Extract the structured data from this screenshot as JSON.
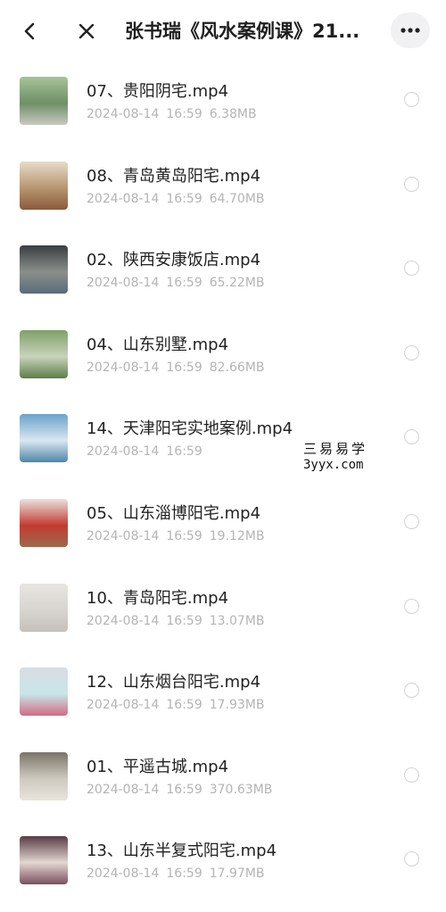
{
  "header": {
    "title": "张书瑞《风水案例课》21...",
    "back_icon": "chevron-left-icon",
    "close_icon": "close-icon",
    "more_icon": "more-horizontal-icon"
  },
  "files": [
    {
      "name": "07、贵阳阴宅.mp4",
      "date": "2024-08-14",
      "time": "16:59",
      "size": "6.38MB",
      "thumb": {
        "top": "#a7c39a",
        "mid": "#6f8f66",
        "bottom": "#c9c9c0"
      }
    },
    {
      "name": "08、青岛黄岛阳宅.mp4",
      "date": "2024-08-14",
      "time": "16:59",
      "size": "64.70MB",
      "thumb": {
        "top": "#e6dccb",
        "mid": "#b7956f",
        "bottom": "#8a5a3c"
      }
    },
    {
      "name": "02、陕西安康饭店.mp4",
      "date": "2024-08-14",
      "time": "16:59",
      "size": "65.22MB",
      "thumb": {
        "top": "#3a3d42",
        "mid": "#8b8f8a",
        "bottom": "#5a6b7a"
      }
    },
    {
      "name": "04、山东别墅.mp4",
      "date": "2024-08-14",
      "time": "16:59",
      "size": "82.66MB",
      "thumb": {
        "top": "#7fa06a",
        "mid": "#c9d3bb",
        "bottom": "#5d7d4a"
      }
    },
    {
      "name": "14、天津阳宅实地案例.mp4",
      "date": "2024-08-14",
      "time": "16:59",
      "size": "",
      "thumb": {
        "top": "#6aa3c9",
        "mid": "#d9e7ef",
        "bottom": "#4f86a8"
      }
    },
    {
      "name": "05、山东淄博阳宅.mp4",
      "date": "2024-08-14",
      "time": "16:59",
      "size": "19.12MB",
      "thumb": {
        "top": "#e9e3dc",
        "mid": "#c43b30",
        "bottom": "#9b6b4e"
      }
    },
    {
      "name": "10、青岛阳宅.mp4",
      "date": "2024-08-14",
      "time": "16:59",
      "size": "13.07MB",
      "thumb": {
        "top": "#e8e6e3",
        "mid": "#d8d4cf",
        "bottom": "#c5c0ba"
      }
    },
    {
      "name": "12、山东烟台阳宅.mp4",
      "date": "2024-08-14",
      "time": "16:59",
      "size": "17.93MB",
      "thumb": {
        "top": "#d9dde3",
        "mid": "#c8e6e8",
        "bottom": "#d16b86"
      }
    },
    {
      "name": "01、平遥古城.mp4",
      "date": "2024-08-14",
      "time": "16:59",
      "size": "370.63MB",
      "thumb": {
        "top": "#7a7468",
        "mid": "#cfcac0",
        "bottom": "#e8e4dc"
      }
    },
    {
      "name": "13、山东半复式阳宅.mp4",
      "date": "2024-08-14",
      "time": "16:59",
      "size": "17.97MB",
      "thumb": {
        "top": "#5a3b46",
        "mid": "#e3d6d0",
        "bottom": "#7a5060"
      }
    }
  ],
  "watermark": {
    "cn": "三易易学",
    "en": "3yyx.com"
  },
  "colors": {
    "text_primary": "#222222",
    "text_meta": "#b4b4b4",
    "more_button_bg": "#f1f1f3"
  }
}
